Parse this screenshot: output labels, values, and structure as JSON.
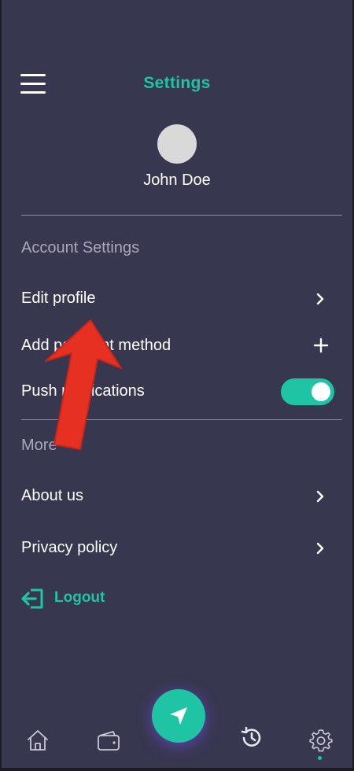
{
  "header": {
    "title": "Settings"
  },
  "profile": {
    "name": "John Doe"
  },
  "account_section": {
    "label": "Account Settings",
    "items": [
      {
        "label": "Edit profile",
        "action": "chevron-right-icon"
      },
      {
        "label": "Add payment method",
        "action": "plus-icon"
      },
      {
        "label": "Push notifications",
        "action": "toggle",
        "enabled": true
      }
    ]
  },
  "more_section": {
    "label": "More",
    "items": [
      {
        "label": "About us",
        "action": "chevron-right-icon"
      },
      {
        "label": "Privacy policy",
        "action": "chevron-right-icon"
      }
    ]
  },
  "logout": {
    "label": "Logout",
    "icon": "logout-icon"
  },
  "bottom_nav": {
    "items": [
      "home-icon",
      "wallet-icon",
      "navigate-icon",
      "history-icon",
      "settings-icon"
    ],
    "active": "settings-icon"
  },
  "colors": {
    "background": "#383750",
    "accent": "#1ec4a4",
    "text": "#ffffff",
    "muted_text": "#a9a8ba",
    "annotation_arrow": "#e53022"
  }
}
